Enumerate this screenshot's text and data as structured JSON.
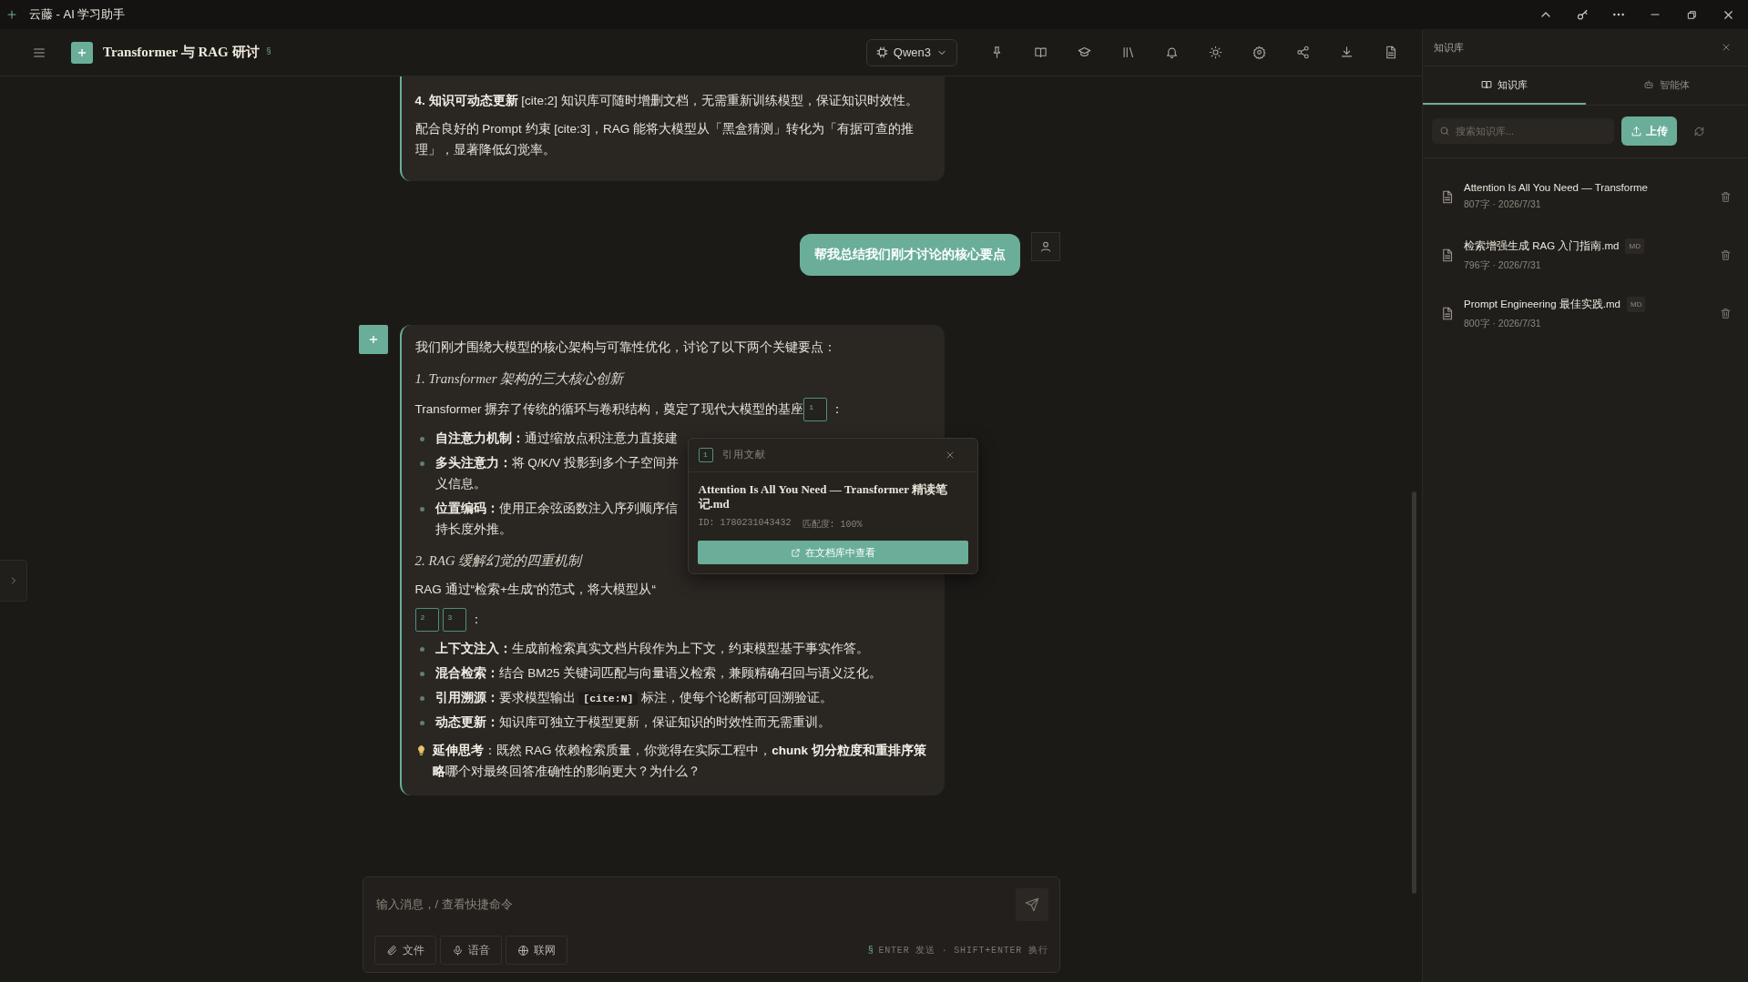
{
  "window": {
    "title": "云藤 - AI 学习助手"
  },
  "header": {
    "title": "Transformer 与 RAG 研讨",
    "badge": "§",
    "model": "Qwen3"
  },
  "messages": [
    {
      "kind": "continued",
      "blocks": [
        {
          "kind": "paragraph",
          "text": "**4. 知识可动态更新** [cite:2] 知识库可随时增删文档，无需重新训练模型，保证知识时效性。"
        },
        {
          "kind": "paragraph",
          "text": "配合良好的 Prompt 约束 [cite:3]，RAG 能将大模型从「黑盒猜测」转化为「有据可查的推理」，显著降低幻觉率。"
        }
      ]
    },
    {
      "kind": "user",
      "text": "帮我总结我们刚才讨论的核心要点"
    },
    {
      "kind": "full",
      "blocks": [
        {
          "kind": "paragraph",
          "text": "我们刚才围绕大模型的核心架构与可靠性优化，讨论了以下两个关键要点："
        },
        {
          "kind": "heading",
          "text": "1. Transformer 架构的三大核心创新"
        },
        {
          "kind": "paragraph",
          "text": "Transformer 摒弃了传统的循环与卷积结构，奠定了现代大模型的基座",
          "cites": [
            "1"
          ],
          "after": "："
        },
        {
          "kind": "list",
          "items": [
            {
              "label": "自注意力机制：",
              "text": "通过缩放点积注意力直接建"
            },
            {
              "label": "多头注意力：",
              "text": "将 Q/K/V 投影到多个子空间并",
              "wrap": "义信息。"
            },
            {
              "label": "位置编码：",
              "text": "使用正余弦函数注入序列顺序信",
              "wrap": "持长度外推。"
            }
          ]
        },
        {
          "kind": "heading",
          "text": "2. RAG 缓解幻觉的四重机制"
        },
        {
          "kind": "paragraph",
          "text": "RAG 通过“检索+生成”的范式，将大模型从“"
        },
        {
          "kind": "citations",
          "cites": [
            "2",
            "3"
          ],
          "after": "："
        },
        {
          "kind": "list",
          "items": [
            {
              "label": "上下文注入：",
              "text": "生成前检索真实文档片段作为上下文，约束模型基于事实作答。"
            },
            {
              "label": "混合检索：",
              "text": "结合 BM25 关键词匹配与向量语义检索，兼顾精确召回与语义泛化。"
            },
            {
              "label": "引用溯源：",
              "text": "要求模型输出 ",
              "code": "[cite:N]",
              "after": " 标注，使每个论断都可回溯验证。"
            },
            {
              "label": "动态更新：",
              "text": "知识库可独立于模型更新，保证知识的时效性而无需重训。"
            }
          ]
        },
        {
          "kind": "tip",
          "text": "**延伸思考**：既然 RAG 依赖检索质量，你觉得在实际工程中，**chunk 切分粒度和重排序策略**哪个对最终回答准确性的影响更大？为什么？"
        }
      ]
    }
  ],
  "citation_popup": {
    "cite": "1",
    "label": "引用文献",
    "title": "Attention Is All You Need — Transformer 精读笔记.md",
    "id": "ID: 1780231043432",
    "match": "匹配度: 100%",
    "action": "在文档库中查看"
  },
  "composer": {
    "placeholder": "输入消息，/ 查看快捷命令",
    "tools": [
      {
        "kind": "attach",
        "label": "文件"
      },
      {
        "kind": "mic",
        "label": "语音"
      },
      {
        "kind": "globe",
        "label": "联网"
      }
    ],
    "hint_symbol": "§",
    "hint": "ENTER 发送 · SHIFT+ENTER 换行"
  },
  "panel": {
    "title": "知识库",
    "tabs": [
      {
        "kind": "book",
        "label": "知识库",
        "selected": true
      },
      {
        "kind": "bot",
        "label": "智能体",
        "selected": false
      }
    ],
    "search": {
      "placeholder": "搜索知识库..."
    },
    "upload": "上传",
    "documents": [
      {
        "title": "Attention Is All You Need — Transforme",
        "meta": "807字 · 2026/7/31"
      },
      {
        "title": "检索增强生成 RAG 入门指南.md",
        "badge": "MD",
        "meta": "796字 · 2026/7/31"
      },
      {
        "title": "Prompt Engineering 最佳实践.md",
        "badge": "MD",
        "meta": "800字 · 2026/7/31"
      }
    ]
  }
}
